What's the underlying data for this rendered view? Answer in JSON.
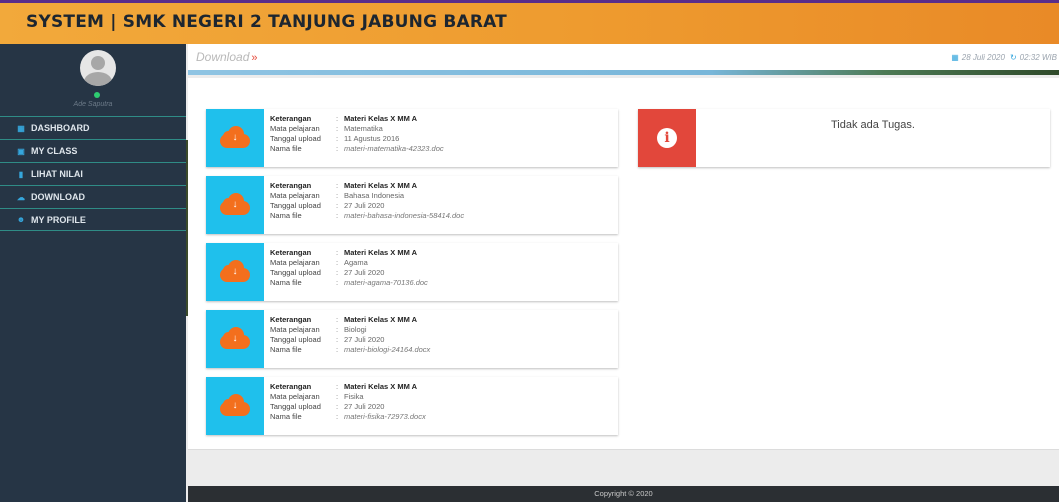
{
  "header": {
    "title": "SYSTEM | SMK NEGERI 2 TANJUNG JABUNG BARAT"
  },
  "sidebar": {
    "username": "Ade Saputra",
    "items": [
      {
        "label": "DASHBOARD",
        "icon": "dashboard-icon"
      },
      {
        "label": "MY CLASS",
        "icon": "institution-icon"
      },
      {
        "label": "LIHAT NILAI",
        "icon": "book-icon"
      },
      {
        "label": "DOWNLOAD",
        "icon": "cloud-download-icon"
      },
      {
        "label": "MY PROFILE",
        "icon": "users-icon"
      }
    ]
  },
  "breadcrumb": {
    "current": "Download",
    "separator": "»"
  },
  "datetime": {
    "date": "28 Juli 2020",
    "time": "02:32 WIB"
  },
  "labels": {
    "keterangan": "Keterangan",
    "mapel": "Mata pelajaran",
    "tanggal": "Tanggal upload",
    "file": "Nama file",
    "sep": ":"
  },
  "materials": [
    {
      "keterangan": "Materi Kelas X MM A",
      "mapel": "Matematika",
      "tanggal": "11 Agustus 2016",
      "file": "materi-matematika-42323.doc"
    },
    {
      "keterangan": "Materi Kelas X MM A",
      "mapel": "Bahasa Indonesia",
      "tanggal": "27 Juli 2020",
      "file": "materi-bahasa-indonesia-58414.doc"
    },
    {
      "keterangan": "Materi Kelas X MM A",
      "mapel": "Agama",
      "tanggal": "27 Juli 2020",
      "file": "materi-agama-70136.doc"
    },
    {
      "keterangan": "Materi Kelas X MM A",
      "mapel": "Biologi",
      "tanggal": "27 Juli 2020",
      "file": "materi-biologi-24164.docx"
    },
    {
      "keterangan": "Materi Kelas X MM A",
      "mapel": "Fisika",
      "tanggal": "27 Juli 2020",
      "file": "materi-fisika-72973.docx"
    }
  ],
  "tugas_alert": {
    "message": "Tidak ada Tugas.",
    "icon": "info-icon",
    "color": "#e2473b"
  },
  "footer": {
    "text": "Copyright © 2020"
  },
  "colors": {
    "header": "#ee9b2f",
    "sidebar": "#263545",
    "download_box": "#1fc0ec",
    "cloud": "#f36f1d"
  }
}
